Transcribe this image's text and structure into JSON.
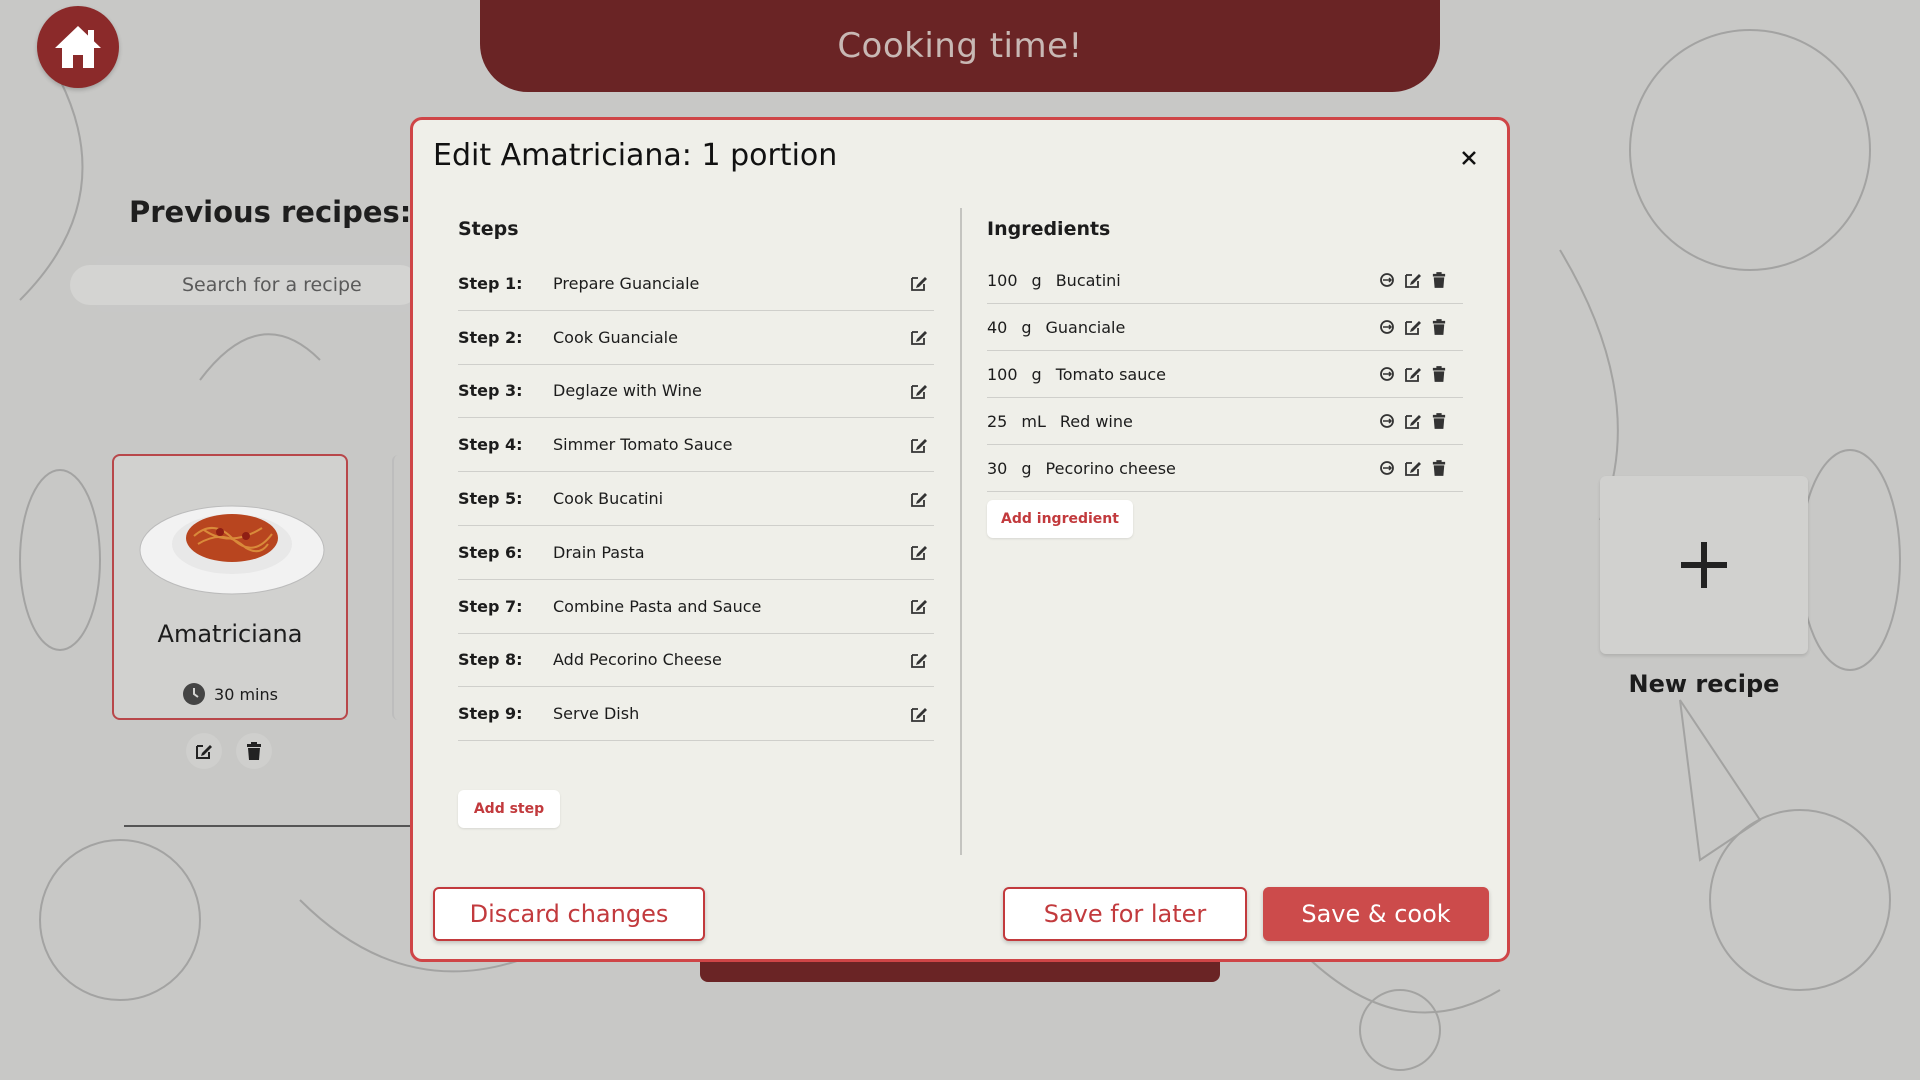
{
  "header": {
    "title": "Cooking time!"
  },
  "sidebar": {
    "previous_title": "Previous recipes:",
    "search_placeholder": "Search for a recipe"
  },
  "recipe_card": {
    "name": "Amatriciana",
    "time": "30 mins"
  },
  "new_recipe": {
    "label": "New recipe",
    "icon": "plus-icon"
  },
  "modal": {
    "title": "Edit Amatriciana: 1 portion",
    "steps_title": "Steps",
    "ingredients_title": "Ingredients",
    "steps": [
      {
        "num": "Step 1:",
        "text": "Prepare Guanciale"
      },
      {
        "num": "Step 2:",
        "text": "Cook Guanciale"
      },
      {
        "num": "Step 3:",
        "text": "Deglaze with Wine"
      },
      {
        "num": "Step 4:",
        "text": "Simmer Tomato Sauce"
      },
      {
        "num": "Step 5:",
        "text": "Cook Bucatini"
      },
      {
        "num": "Step 6:",
        "text": "Drain Pasta"
      },
      {
        "num": "Step 7:",
        "text": "Combine Pasta and Sauce"
      },
      {
        "num": "Step 8:",
        "text": "Add Pecorino Cheese"
      },
      {
        "num": "Step 9:",
        "text": "Serve Dish"
      }
    ],
    "ingredients": [
      {
        "qty": "100",
        "unit": "g",
        "name": "Bucatini"
      },
      {
        "qty": "40",
        "unit": "g",
        "name": "Guanciale"
      },
      {
        "qty": "100",
        "unit": "g",
        "name": "Tomato sauce"
      },
      {
        "qty": "25",
        "unit": "mL",
        "name": "Red wine"
      },
      {
        "qty": "30",
        "unit": "g",
        "name": "Pecorino cheese"
      }
    ],
    "add_ingredient_label": "Add ingredient",
    "add_step_label": "Add step",
    "discard_label": "Discard changes",
    "save_later_label": "Save for later",
    "save_cook_label": "Save & cook"
  },
  "colors": {
    "brand": "#6a2425",
    "accent": "#cc4b4b",
    "modal_bg": "#efefe9"
  }
}
